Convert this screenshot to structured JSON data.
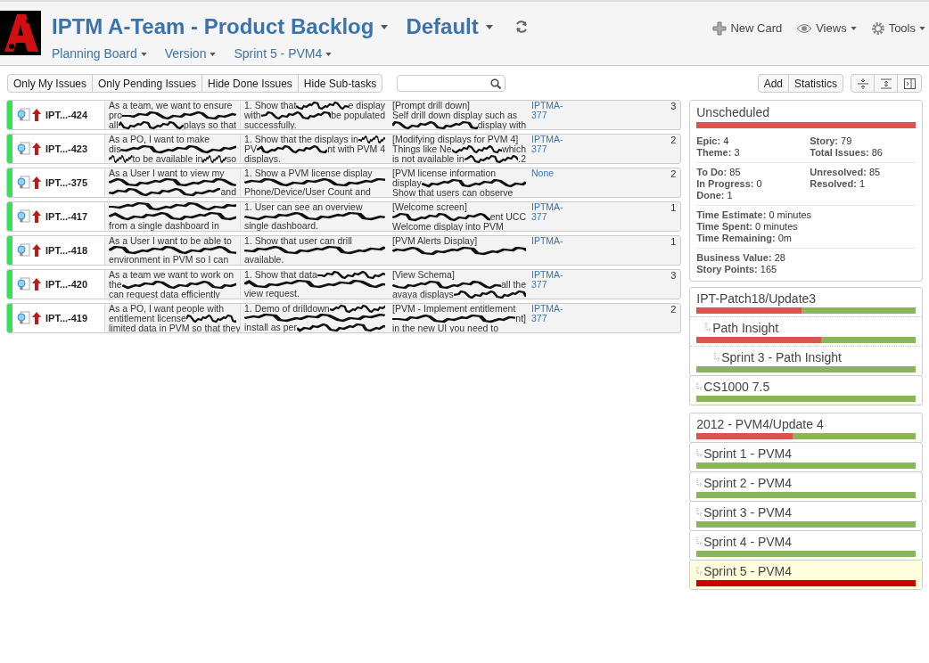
{
  "header": {
    "title": "IPTM A-Team - Product Backlog",
    "board": "Default",
    "nav": [
      "Planning Board",
      "Version",
      "Sprint 5 - PVM4"
    ],
    "actions": [
      {
        "kind": "new",
        "label": "New Card"
      },
      {
        "kind": "views",
        "label": "Views"
      },
      {
        "kind": "tools",
        "label": "Tools"
      }
    ]
  },
  "filters": [
    "Only My Issues",
    "Only Pending Issues",
    "Hide Done Issues",
    "Hide Sub-tasks"
  ],
  "right_buttons": [
    "Add",
    "Statistics"
  ],
  "cards": [
    {
      "key": "IPT...-424",
      "points": "3",
      "summary": [
        [
          "As a team, we want to ensure"
        ],
        [
          "pro",
          {
            "kind": "scribble"
          }
        ],
        [
          "all",
          {
            "kind": "scribble"
          },
          "plays so that"
        ]
      ],
      "acceptance": [
        [
          "1. Show that",
          {
            "kind": "scribble"
          },
          "e display"
        ],
        [
          "with",
          {
            "kind": "scribble"
          },
          "be populated"
        ],
        [
          "successfully."
        ]
      ],
      "description": [
        [
          "[Prompt drill down]"
        ],
        [
          "Self drill down display such as"
        ],
        [
          {
            "kind": "scribble"
          },
          "display with"
        ]
      ],
      "link": [
        "IPTMA-",
        "377"
      ]
    },
    {
      "key": "IPT...-423",
      "points": "2",
      "summary": [
        [
          "As a PO, I want to make"
        ],
        [
          "dis",
          {
            "kind": "scribble"
          }
        ],
        [
          {
            "kind": "scribble"
          },
          "to be available in",
          {
            "kind": "scribble"
          },
          "so"
        ]
      ],
      "acceptance": [
        [
          "1. Show that the displays in",
          {
            "kind": "scribble"
          }
        ],
        [
          "PV",
          {
            "kind": "scribble"
          },
          "nt with PVM 4"
        ],
        [
          "displays."
        ]
      ],
      "description": [
        [
          "[Modifying displays for PVM 4]"
        ],
        [
          "Things like Ne",
          {
            "kind": "scribble"
          },
          "which"
        ],
        [
          "is not available in",
          {
            "kind": "scribble"
          },
          ".2"
        ]
      ],
      "link": [
        "IPTMA-",
        "377"
      ]
    },
    {
      "key": "IPT...-375",
      "points": "2",
      "summary": [
        [
          "As a User I want to view my"
        ],
        [
          {
            "kind": "scribble"
          }
        ],
        [
          {
            "kind": "scribble"
          },
          "and"
        ]
      ],
      "acceptance": [
        [
          "1. Show a PVM license display"
        ],
        [
          {
            "kind": "scribble"
          }
        ],
        [
          "Phone/Device/User Count and"
        ]
      ],
      "description": [
        [
          "[PVM license information"
        ],
        [
          "display",
          {
            "kind": "scribble"
          }
        ],
        [
          "Show that users can observe"
        ]
      ],
      "link": [
        "None"
      ]
    },
    {
      "key": "IPT...-417",
      "points": "1",
      "summary": [
        [
          {
            "kind": "scribble"
          }
        ],
        [
          {
            "kind": "scribble"
          }
        ],
        [
          "from a single dashboard in"
        ]
      ],
      "acceptance": [
        [
          "1. User can see an overview"
        ],
        [
          {
            "kind": "scribble"
          }
        ],
        [
          "single dashboard."
        ]
      ],
      "description": [
        [
          "[Welcome screen]"
        ],
        [
          {
            "kind": "scribble"
          },
          "ent UCC"
        ],
        [
          "Welcome display into PVM"
        ]
      ],
      "link": [
        "IPTMA-",
        "377"
      ]
    },
    {
      "key": "IPT...-418",
      "points": "1",
      "summary": [
        [
          "As a User I want to be able to"
        ],
        [
          {
            "kind": "scribble"
          }
        ],
        [
          "environment in PVM so I can"
        ]
      ],
      "acceptance": [
        [
          "1. Show that user can drill"
        ],
        [
          {
            "kind": "scribble"
          }
        ],
        [
          "available."
        ]
      ],
      "description": [
        [
          "[PVM Alerts Display]"
        ],
        [
          {
            "kind": "scribble"
          }
        ]
      ],
      "link": [
        "IPTMA-"
      ]
    },
    {
      "key": "IPT...-420",
      "points": "3",
      "summary": [
        [
          "As a team we want to work on"
        ],
        [
          "the",
          {
            "kind": "scribble"
          }
        ],
        [
          "can request data efficiently"
        ]
      ],
      "acceptance": [
        [
          "1. Show that data",
          {
            "kind": "scribble"
          }
        ],
        [
          {
            "kind": "scribble"
          }
        ],
        [
          "view request."
        ]
      ],
      "description": [
        [
          "[View Schema]"
        ],
        [
          {
            "kind": "scribble"
          },
          "all the"
        ],
        [
          "avaya displays",
          {
            "kind": "scribble"
          }
        ]
      ],
      "link": [
        "IPTMA-",
        "377"
      ]
    },
    {
      "key": "IPT...-419",
      "points": "2",
      "summary": [
        [
          "As a PO, I want people with"
        ],
        [
          "entitlement license",
          {
            "kind": "scribble"
          }
        ],
        [
          "limited data in PVM so that they"
        ]
      ],
      "acceptance": [
        [
          "1. Demo of drilldown",
          {
            "kind": "scribble"
          }
        ],
        [
          {
            "kind": "scribble"
          }
        ],
        [
          "install as per",
          {
            "kind": "scribble"
          }
        ]
      ],
      "description": [
        [
          "[PVM - Implement entitlement"
        ],
        [
          {
            "kind": "scribble"
          },
          "nt]"
        ],
        [
          "in the new UI you need to"
        ]
      ],
      "link": [
        "IPTMA-",
        "377"
      ]
    }
  ],
  "unscheduled": {
    "title": "Unscheduled",
    "level": 0,
    "groups": [
      [
        {
          "label": "Epic:",
          "value": "4"
        },
        {
          "label": "Story:",
          "value": "79"
        },
        {
          "label": "Theme:",
          "value": "3"
        },
        {
          "label": "Total Issues:",
          "value": "86"
        }
      ],
      [
        {
          "label": "To Do:",
          "value": "85"
        },
        {
          "label": "Unresolved:",
          "value": "85"
        },
        {
          "label": "In Progress:",
          "value": "0"
        },
        {
          "label": "Resolved:",
          "value": "1"
        },
        {
          "label": "Done:",
          "value": "1"
        }
      ],
      [
        {
          "label": "Time Estimate:",
          "value": "0 minutes"
        },
        {
          "label": "Time Spent:",
          "value": "0 minutes"
        },
        {
          "label": "Time Remaining:",
          "value": "0m"
        }
      ],
      [
        {
          "label": "Business Value:",
          "value": "28"
        },
        {
          "label": "Story Points:",
          "value": "165"
        }
      ]
    ]
  },
  "versions": [
    {
      "name": "IPT-Patch18/Update3",
      "sub": false,
      "level": 0.52,
      "selected": false,
      "children": [
        {
          "name": "Path Insight",
          "sub": true,
          "level": 0.43,
          "selected": false,
          "children": [
            {
              "name": "Sprint 3 - Path Insight",
              "sub": true,
              "level": 1,
              "selected": false
            }
          ]
        }
      ]
    },
    {
      "name": "CS1000 7.5",
      "sub": true,
      "level": 1,
      "selected": false
    },
    {
      "name": "2012 - PVM4/Update 4",
      "sub": false,
      "level": 0.56,
      "selected": false
    },
    {
      "name": "Sprint 1 - PVM4",
      "sub": true,
      "level": 1,
      "selected": false
    },
    {
      "name": "Sprint 2 - PVM4",
      "sub": true,
      "level": 1,
      "selected": false
    },
    {
      "name": "Sprint 3 - PVM4",
      "sub": true,
      "level": 1,
      "selected": false
    },
    {
      "name": "Sprint 4 - PVM4",
      "sub": true,
      "level": 1,
      "selected": false
    },
    {
      "name": "Sprint 5 - PVM4",
      "sub": true,
      "level": 0,
      "selected": true
    }
  ]
}
